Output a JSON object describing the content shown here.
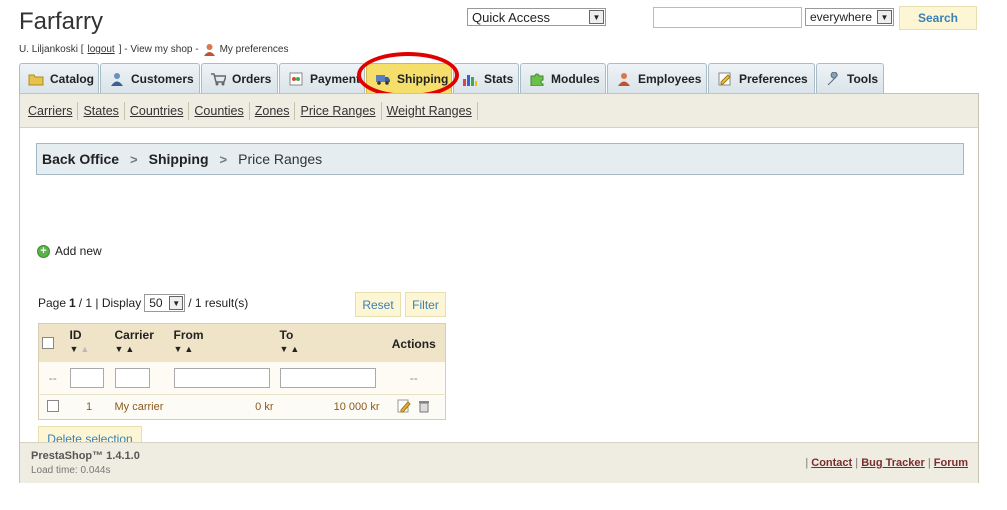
{
  "header": {
    "shop_name": "Farfarry",
    "user": "U. Liljankoski [",
    "logout": "logout",
    "user_after": "] - View my shop -",
    "preferences_link": "My preferences",
    "quick_access": "Quick Access",
    "search_value": "",
    "search_scope": "everywhere",
    "search_button": "Search"
  },
  "tabs": [
    {
      "label": "Catalog",
      "icon": "folder-icon"
    },
    {
      "label": "Customers",
      "icon": "customers-icon"
    },
    {
      "label": "Orders",
      "icon": "cart-icon"
    },
    {
      "label": "Payment",
      "icon": "payment-icon"
    },
    {
      "label": "Shipping",
      "icon": "truck-icon",
      "active": true
    },
    {
      "label": "Stats",
      "icon": "stats-icon"
    },
    {
      "label": "Modules",
      "icon": "puzzle-icon"
    },
    {
      "label": "Employees",
      "icon": "employee-icon"
    },
    {
      "label": "Preferences",
      "icon": "preferences-icon"
    },
    {
      "label": "Tools",
      "icon": "wrench-icon"
    }
  ],
  "subnav": [
    "Carriers",
    "States",
    "Countries",
    "Counties",
    "Zones",
    "Price Ranges",
    "Weight Ranges"
  ],
  "breadcrumb": {
    "root": "Back Office",
    "section": "Shipping",
    "current": "Price Ranges"
  },
  "add_new": "Add new",
  "pager": {
    "page_label": "Page",
    "page": "1",
    "of": "/ 1 | Display",
    "per_page": "50",
    "results": "/ 1 result(s)"
  },
  "buttons": {
    "reset": "Reset",
    "filter": "Filter",
    "delete_selection": "Delete selection"
  },
  "table": {
    "headers": {
      "id": "ID",
      "carrier": "Carrier",
      "from": "From",
      "to": "To",
      "actions": "Actions"
    },
    "filter_placeholder": "--",
    "filter_actions": "--",
    "rows": [
      {
        "id": "1",
        "carrier": "My carrier",
        "from": "0 kr",
        "to": "10 000 kr"
      }
    ]
  },
  "footer": {
    "version": "PrestaShop™ 1.4.1.0",
    "load_time": "Load time: 0.044s",
    "links": [
      "Contact",
      "Bug Tracker",
      "Forum"
    ]
  },
  "colors": {
    "active_tab": "#f6de6a",
    "highlight_circle": "#e00000",
    "link_brown": "#7a2d2d"
  }
}
